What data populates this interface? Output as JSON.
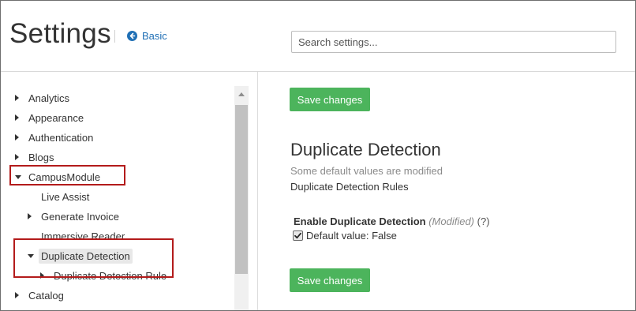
{
  "header": {
    "title": "Settings",
    "basic_link": "Basic",
    "search_placeholder": "Search settings..."
  },
  "sidebar": {
    "items": [
      {
        "label": "Analytics",
        "expander": "collapsed"
      },
      {
        "label": "Appearance",
        "expander": "collapsed"
      },
      {
        "label": "Authentication",
        "expander": "collapsed"
      },
      {
        "label": "Blogs",
        "expander": "collapsed"
      },
      {
        "label": "CampusModule",
        "expander": "expanded"
      },
      {
        "label": "Live Assist",
        "expander": "none"
      },
      {
        "label": "Generate Invoice",
        "expander": "collapsed"
      },
      {
        "label": "Immersive Reader",
        "expander": "none"
      },
      {
        "label": "Duplicate Detection",
        "expander": "expanded",
        "selected": true
      },
      {
        "label": "Duplicate Detection Rule",
        "expander": "collapsed"
      },
      {
        "label": "Catalog",
        "expander": "collapsed"
      }
    ]
  },
  "main": {
    "save_label_top": "Save changes",
    "save_label_bottom": "Save changes",
    "section_title": "Duplicate Detection",
    "section_subtitle": "Some default values are modified",
    "section_link": "Duplicate Detection Rules",
    "setting": {
      "label": "Enable Duplicate Detection",
      "modified": "(Modified)",
      "help": "(?)",
      "checked": true,
      "default_text": "Default value: False"
    }
  },
  "colors": {
    "accent_link": "#1f6fb5",
    "save_button": "#4cb45c",
    "highlight_box": "#b31b1b"
  },
  "icons": {
    "back": "arrow-left-circle-icon",
    "expand": "caret-right-icon",
    "collapse": "caret-down-icon",
    "check": "check-icon"
  }
}
